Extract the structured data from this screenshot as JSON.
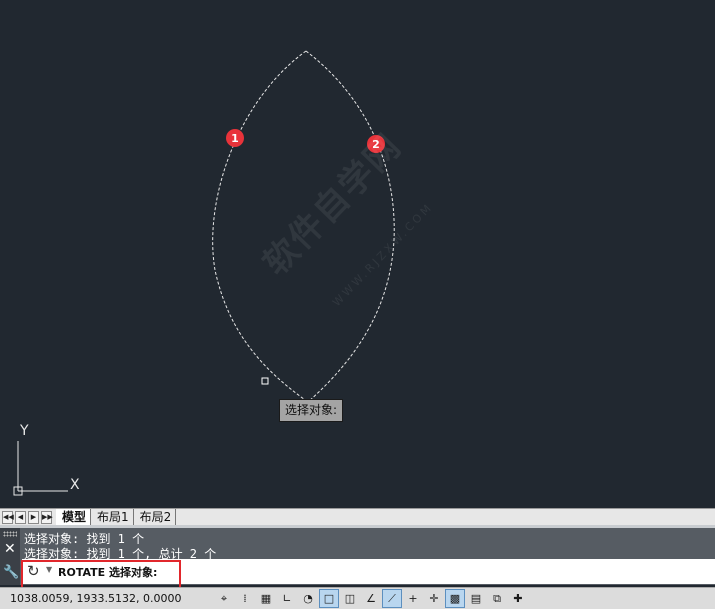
{
  "drawing": {
    "marker_1": "1",
    "marker_2": "2",
    "tooltip": "选择对象:",
    "watermark": "软件自学网",
    "watermark_url": "WWW.RJZXW.COM",
    "ucs_x": "X",
    "ucs_y": "Y"
  },
  "tabs": {
    "nav": [
      "◀◀",
      "◀",
      "▶",
      "▶▶"
    ],
    "items": [
      "模型",
      "布局1",
      "布局2"
    ],
    "active": "模型"
  },
  "command": {
    "history": [
      "选择对象: 找到 1 个",
      "选择对象: 找到 1 个, 总计 2 个"
    ],
    "prompt": "ROTATE 选择对象:"
  },
  "status": {
    "coordinates": "1038.0059,  1933.5132,  0.0000"
  },
  "status_icons": [
    "infer-constraints-icon",
    "snap-icon",
    "grid-icon",
    "ortho-icon",
    "polar-icon",
    "osnap-icon",
    "3d-osnap-icon",
    "otrack-icon",
    "ducs-icon",
    "dyn-icon",
    "lineweight-icon",
    "transparency-icon",
    "quick-properties-icon",
    "selection-cycling-icon",
    "annotation-monitor-icon"
  ],
  "colors": {
    "canvas": "#212830",
    "highlight": "#e1272c",
    "marker": "#e8333a"
  }
}
